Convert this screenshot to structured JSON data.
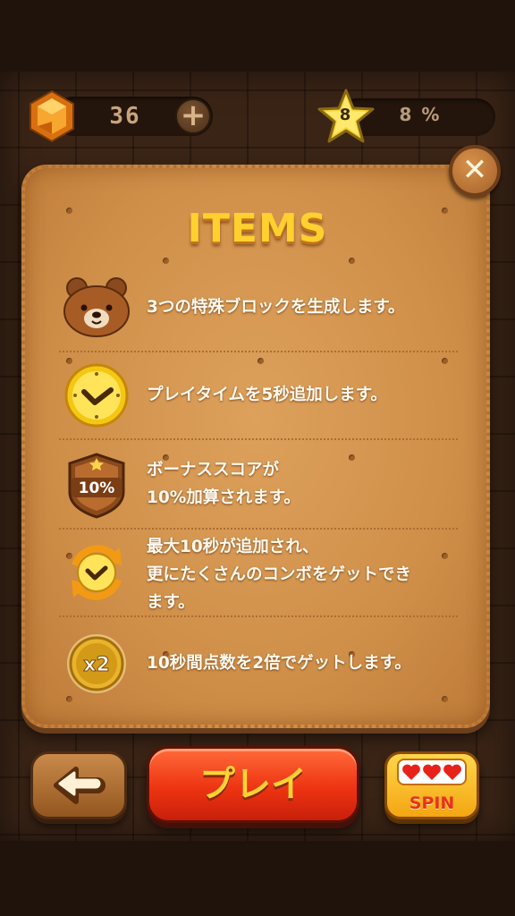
{
  "hud": {
    "gem_count": "36",
    "add_label": "+",
    "level": "8",
    "progress_text": "8 %",
    "progress": 0.08
  },
  "panel": {
    "title": "ITEMS",
    "close_label": "✕",
    "items": [
      {
        "icon": "bear-icon",
        "text": "3つの特殊ブロックを生成します。"
      },
      {
        "icon": "clock-icon",
        "text": "プレイタイムを5秒追加します。"
      },
      {
        "icon": "bonus-shield-icon",
        "badge": "10%",
        "text": "ボーナススコアが\n10%加算されます。"
      },
      {
        "icon": "clock-refresh-icon",
        "text": "最大10秒が追加され、\n更にたくさんのコンボをゲットでき\nます。"
      },
      {
        "icon": "x2-coin-icon",
        "badge": "x2",
        "text": "10秒間点数を2倍でゲットします。"
      }
    ]
  },
  "buttons": {
    "back": "←",
    "play": "プレイ",
    "spin": "SPIN"
  },
  "colors": {
    "title_yellow": "#ffd02e",
    "biscuit": "#d3924b",
    "play_red": "#ee3412",
    "spin_yellow": "#ffd64a"
  }
}
